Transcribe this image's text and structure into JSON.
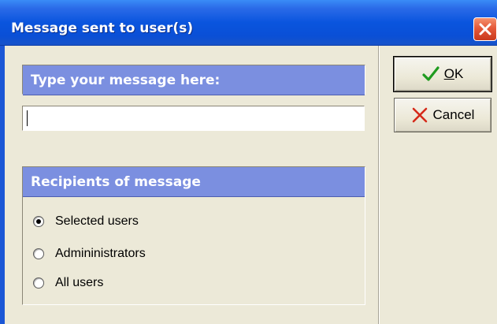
{
  "window": {
    "title": "Message sent to user(s)"
  },
  "message": {
    "header": "Type your message here:",
    "value": ""
  },
  "recipients": {
    "header": "Recipients of message",
    "options": [
      {
        "label": "Selected users",
        "selected": true
      },
      {
        "label": "Admininistrators",
        "selected": false
      },
      {
        "label": "All users",
        "selected": false
      }
    ]
  },
  "buttons": {
    "ok_underlined": "O",
    "ok_rest": "K",
    "cancel_label": "Cancel"
  },
  "icons": {
    "close": "close-icon",
    "ok": "checkmark-icon",
    "cancel": "cross-icon"
  },
  "colors": {
    "titlebar": "#0a55de",
    "group_header": "#7b8fe0",
    "ok_check": "#1f9b1f",
    "cancel_cross": "#d52a1a",
    "close_button": "#e5593a"
  }
}
